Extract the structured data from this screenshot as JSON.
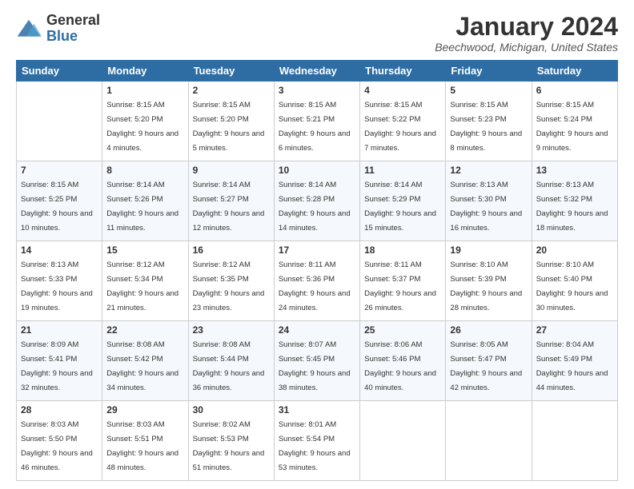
{
  "logo": {
    "general": "General",
    "blue": "Blue"
  },
  "header": {
    "month": "January 2024",
    "location": "Beechwood, Michigan, United States"
  },
  "days_of_week": [
    "Sunday",
    "Monday",
    "Tuesday",
    "Wednesday",
    "Thursday",
    "Friday",
    "Saturday"
  ],
  "weeks": [
    [
      {
        "day": "",
        "sunrise": "",
        "sunset": "",
        "daylight": ""
      },
      {
        "day": "1",
        "sunrise": "Sunrise: 8:15 AM",
        "sunset": "Sunset: 5:20 PM",
        "daylight": "Daylight: 9 hours and 4 minutes."
      },
      {
        "day": "2",
        "sunrise": "Sunrise: 8:15 AM",
        "sunset": "Sunset: 5:20 PM",
        "daylight": "Daylight: 9 hours and 5 minutes."
      },
      {
        "day": "3",
        "sunrise": "Sunrise: 8:15 AM",
        "sunset": "Sunset: 5:21 PM",
        "daylight": "Daylight: 9 hours and 6 minutes."
      },
      {
        "day": "4",
        "sunrise": "Sunrise: 8:15 AM",
        "sunset": "Sunset: 5:22 PM",
        "daylight": "Daylight: 9 hours and 7 minutes."
      },
      {
        "day": "5",
        "sunrise": "Sunrise: 8:15 AM",
        "sunset": "Sunset: 5:23 PM",
        "daylight": "Daylight: 9 hours and 8 minutes."
      },
      {
        "day": "6",
        "sunrise": "Sunrise: 8:15 AM",
        "sunset": "Sunset: 5:24 PM",
        "daylight": "Daylight: 9 hours and 9 minutes."
      }
    ],
    [
      {
        "day": "7",
        "sunrise": "Sunrise: 8:15 AM",
        "sunset": "Sunset: 5:25 PM",
        "daylight": "Daylight: 9 hours and 10 minutes."
      },
      {
        "day": "8",
        "sunrise": "Sunrise: 8:14 AM",
        "sunset": "Sunset: 5:26 PM",
        "daylight": "Daylight: 9 hours and 11 minutes."
      },
      {
        "day": "9",
        "sunrise": "Sunrise: 8:14 AM",
        "sunset": "Sunset: 5:27 PM",
        "daylight": "Daylight: 9 hours and 12 minutes."
      },
      {
        "day": "10",
        "sunrise": "Sunrise: 8:14 AM",
        "sunset": "Sunset: 5:28 PM",
        "daylight": "Daylight: 9 hours and 14 minutes."
      },
      {
        "day": "11",
        "sunrise": "Sunrise: 8:14 AM",
        "sunset": "Sunset: 5:29 PM",
        "daylight": "Daylight: 9 hours and 15 minutes."
      },
      {
        "day": "12",
        "sunrise": "Sunrise: 8:13 AM",
        "sunset": "Sunset: 5:30 PM",
        "daylight": "Daylight: 9 hours and 16 minutes."
      },
      {
        "day": "13",
        "sunrise": "Sunrise: 8:13 AM",
        "sunset": "Sunset: 5:32 PM",
        "daylight": "Daylight: 9 hours and 18 minutes."
      }
    ],
    [
      {
        "day": "14",
        "sunrise": "Sunrise: 8:13 AM",
        "sunset": "Sunset: 5:33 PM",
        "daylight": "Daylight: 9 hours and 19 minutes."
      },
      {
        "day": "15",
        "sunrise": "Sunrise: 8:12 AM",
        "sunset": "Sunset: 5:34 PM",
        "daylight": "Daylight: 9 hours and 21 minutes."
      },
      {
        "day": "16",
        "sunrise": "Sunrise: 8:12 AM",
        "sunset": "Sunset: 5:35 PM",
        "daylight": "Daylight: 9 hours and 23 minutes."
      },
      {
        "day": "17",
        "sunrise": "Sunrise: 8:11 AM",
        "sunset": "Sunset: 5:36 PM",
        "daylight": "Daylight: 9 hours and 24 minutes."
      },
      {
        "day": "18",
        "sunrise": "Sunrise: 8:11 AM",
        "sunset": "Sunset: 5:37 PM",
        "daylight": "Daylight: 9 hours and 26 minutes."
      },
      {
        "day": "19",
        "sunrise": "Sunrise: 8:10 AM",
        "sunset": "Sunset: 5:39 PM",
        "daylight": "Daylight: 9 hours and 28 minutes."
      },
      {
        "day": "20",
        "sunrise": "Sunrise: 8:10 AM",
        "sunset": "Sunset: 5:40 PM",
        "daylight": "Daylight: 9 hours and 30 minutes."
      }
    ],
    [
      {
        "day": "21",
        "sunrise": "Sunrise: 8:09 AM",
        "sunset": "Sunset: 5:41 PM",
        "daylight": "Daylight: 9 hours and 32 minutes."
      },
      {
        "day": "22",
        "sunrise": "Sunrise: 8:08 AM",
        "sunset": "Sunset: 5:42 PM",
        "daylight": "Daylight: 9 hours and 34 minutes."
      },
      {
        "day": "23",
        "sunrise": "Sunrise: 8:08 AM",
        "sunset": "Sunset: 5:44 PM",
        "daylight": "Daylight: 9 hours and 36 minutes."
      },
      {
        "day": "24",
        "sunrise": "Sunrise: 8:07 AM",
        "sunset": "Sunset: 5:45 PM",
        "daylight": "Daylight: 9 hours and 38 minutes."
      },
      {
        "day": "25",
        "sunrise": "Sunrise: 8:06 AM",
        "sunset": "Sunset: 5:46 PM",
        "daylight": "Daylight: 9 hours and 40 minutes."
      },
      {
        "day": "26",
        "sunrise": "Sunrise: 8:05 AM",
        "sunset": "Sunset: 5:47 PM",
        "daylight": "Daylight: 9 hours and 42 minutes."
      },
      {
        "day": "27",
        "sunrise": "Sunrise: 8:04 AM",
        "sunset": "Sunset: 5:49 PM",
        "daylight": "Daylight: 9 hours and 44 minutes."
      }
    ],
    [
      {
        "day": "28",
        "sunrise": "Sunrise: 8:03 AM",
        "sunset": "Sunset: 5:50 PM",
        "daylight": "Daylight: 9 hours and 46 minutes."
      },
      {
        "day": "29",
        "sunrise": "Sunrise: 8:03 AM",
        "sunset": "Sunset: 5:51 PM",
        "daylight": "Daylight: 9 hours and 48 minutes."
      },
      {
        "day": "30",
        "sunrise": "Sunrise: 8:02 AM",
        "sunset": "Sunset: 5:53 PM",
        "daylight": "Daylight: 9 hours and 51 minutes."
      },
      {
        "day": "31",
        "sunrise": "Sunrise: 8:01 AM",
        "sunset": "Sunset: 5:54 PM",
        "daylight": "Daylight: 9 hours and 53 minutes."
      },
      {
        "day": "",
        "sunrise": "",
        "sunset": "",
        "daylight": ""
      },
      {
        "day": "",
        "sunrise": "",
        "sunset": "",
        "daylight": ""
      },
      {
        "day": "",
        "sunrise": "",
        "sunset": "",
        "daylight": ""
      }
    ]
  ]
}
